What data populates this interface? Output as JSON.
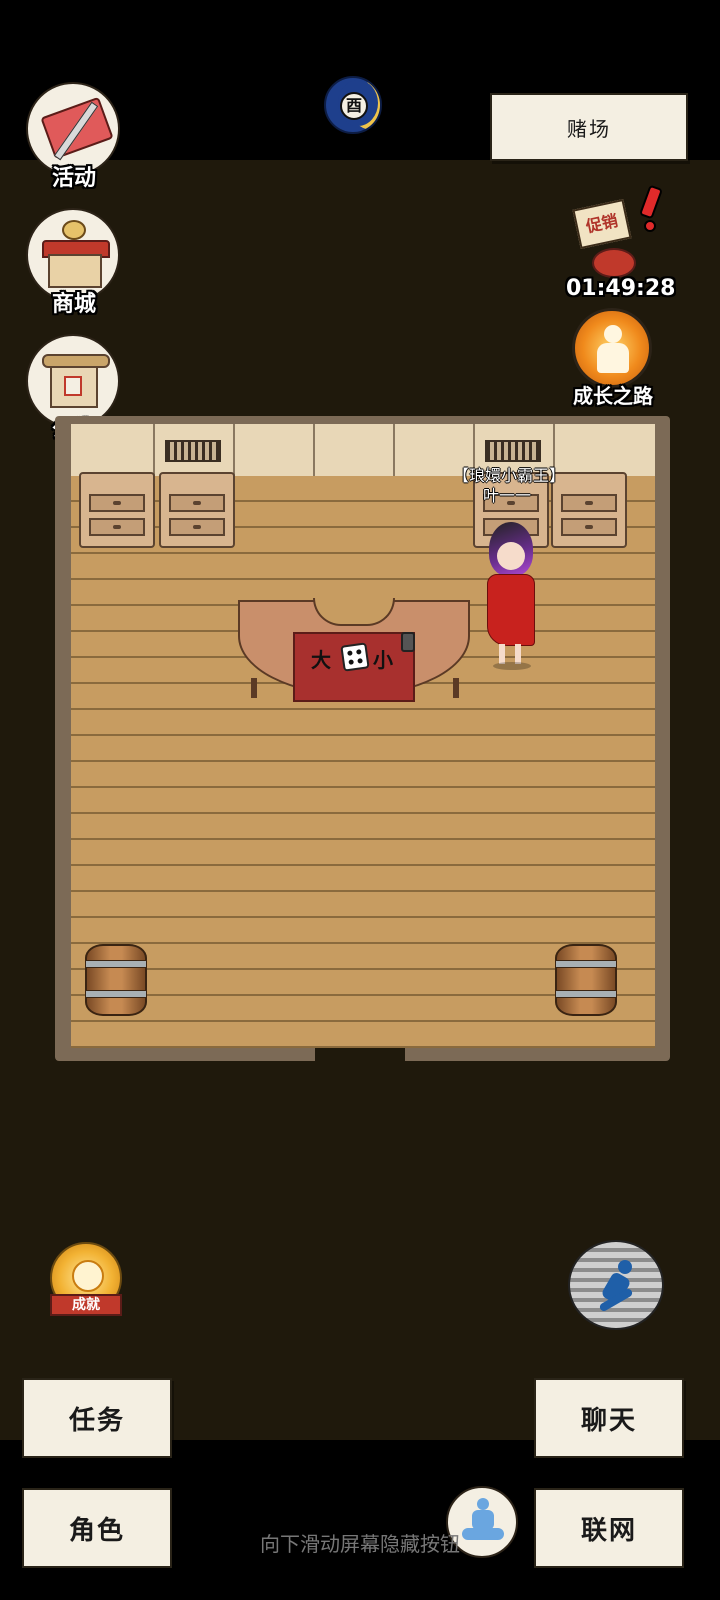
{
  "header": {
    "time_badge": "酉",
    "casino_button": "赌场"
  },
  "left_menu": [
    {
      "label": "活动",
      "icon": "flag-sword-icon"
    },
    {
      "label": "商城",
      "icon": "shop-building-icon"
    },
    {
      "label": "公告",
      "icon": "notice-board-icon"
    }
  ],
  "right_menu": {
    "promo": {
      "sign_text": "促销",
      "timer": "01:49:28",
      "icon": "promo-bag-icon"
    },
    "growth": {
      "label": "成长之路",
      "icon": "growth-person-icon"
    }
  },
  "scene": {
    "room": "casino",
    "table_left_char": "大",
    "table_right_char": "小",
    "npc": {
      "title": "【琅嬛小霸王】",
      "name": "叶一一"
    }
  },
  "bottom": {
    "achievement_label": "成就",
    "quest_button": "任务",
    "character_button": "角色",
    "chat_button": "聊天",
    "network_button": "联网",
    "meditate_icon": "meditation-icon",
    "run_icon": "running-icon"
  },
  "footer_hint": "向下滑动屏幕隐藏按钮",
  "colors": {
    "background": "#1f190c",
    "paper": "#f4efe2",
    "floor": "#c79c61",
    "accent_red": "#a8302e"
  }
}
